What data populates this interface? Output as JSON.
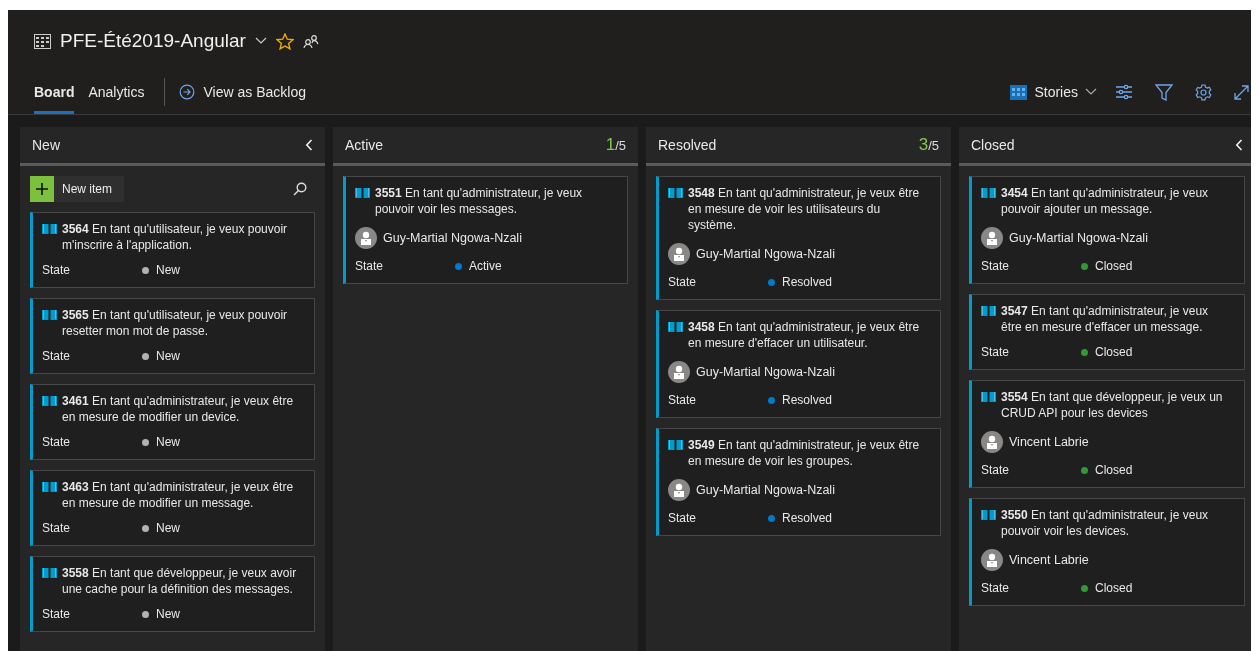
{
  "header": {
    "title": "PFE-Été2019-Angular",
    "favorite": true
  },
  "tabs": [
    {
      "label": "Board",
      "selected": true
    },
    {
      "label": "Analytics",
      "selected": false
    }
  ],
  "backlog_link": "View as Backlog",
  "toolbar": {
    "backlog_level": "Stories"
  },
  "columns": [
    {
      "name": "New",
      "collapsible": true,
      "new_item": "New item",
      "cards": [
        {
          "id": "3564",
          "title": "En tant qu'utilisateur, je veux pouvoir m'inscrire à l'application.",
          "state_label": "State",
          "state": "New",
          "color": "#b2b2b2"
        },
        {
          "id": "3565",
          "title": "En tant qu'utilisateur, je veux pouvoir resetter mon mot de passe.",
          "state_label": "State",
          "state": "New",
          "color": "#b2b2b2"
        },
        {
          "id": "3461",
          "title": "En tant qu'administrateur, je veux être en mesure de modifier un device.",
          "state_label": "State",
          "state": "New",
          "color": "#b2b2b2"
        },
        {
          "id": "3463",
          "title": "En tant qu'administrateur, je veux être en mesure de modifier un message.",
          "state_label": "State",
          "state": "New",
          "color": "#b2b2b2"
        },
        {
          "id": "3558",
          "title": "En tant que développeur, je veux avoir une cache pour la définition des messages.",
          "state_label": "State",
          "state": "New",
          "color": "#b2b2b2"
        }
      ]
    },
    {
      "name": "Active",
      "collapsible": false,
      "count": "1",
      "limit": "/5",
      "cards": [
        {
          "id": "3551",
          "title": "En tant qu'administrateur, je veux pouvoir voir les messages.",
          "assignee": "Guy-Martial Ngowa-Nzali",
          "state_label": "State",
          "state": "Active",
          "color": "#007acc"
        }
      ]
    },
    {
      "name": "Resolved",
      "collapsible": false,
      "count": "3",
      "limit": "/5",
      "cards": [
        {
          "id": "3548",
          "title": "En tant qu'administrateur, je veux être en mesure de voir les utilisateurs du système.",
          "assignee": "Guy-Martial Ngowa-Nzali",
          "state_label": "State",
          "state": "Resolved",
          "color": "#007acc"
        },
        {
          "id": "3458",
          "title": "En tant qu'administrateur, je veux être en mesure d'effacer un utilisateur.",
          "assignee": "Guy-Martial Ngowa-Nzali",
          "state_label": "State",
          "state": "Resolved",
          "color": "#007acc"
        },
        {
          "id": "3549",
          "title": "En tant qu'administrateur, je veux être en mesure de voir les groupes.",
          "assignee": "Guy-Martial Ngowa-Nzali",
          "state_label": "State",
          "state": "Resolved",
          "color": "#007acc"
        }
      ]
    },
    {
      "name": "Closed",
      "collapsible": true,
      "cards": [
        {
          "id": "3454",
          "title": "En tant qu'administrateur, je veux pouvoir ajouter un message.",
          "assignee": "Guy-Martial Ngowa-Nzali",
          "state_label": "State",
          "state": "Closed",
          "color": "#339933"
        },
        {
          "id": "3547",
          "title": "En tant qu'administrateur, je veux être en mesure d'effacer un message.",
          "state_label": "State",
          "state": "Closed",
          "color": "#339933"
        },
        {
          "id": "3554",
          "title": "En tant que développeur, je veux un CRUD API pour les devices",
          "assignee": "Vincent Labrie",
          "state_label": "State",
          "state": "Closed",
          "color": "#339933"
        },
        {
          "id": "3550",
          "title": "En tant qu'administrateur, je veux pouvoir voir les devices.",
          "assignee": "Vincent Labrie",
          "state_label": "State",
          "state": "Closed",
          "color": "#339933"
        }
      ]
    }
  ]
}
